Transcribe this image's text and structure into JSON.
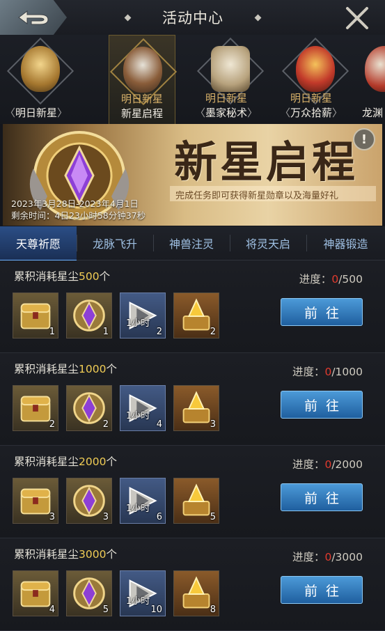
{
  "header": {
    "title": "活动中心"
  },
  "activities": [
    {
      "line1": "",
      "line2": "明日新星",
      "active": false
    },
    {
      "line1": "明日新星",
      "line2": "新星启程",
      "active": true
    },
    {
      "line1": "明日新星",
      "line2": "墨家秘术",
      "active": false
    },
    {
      "line1": "明日新星",
      "line2": "万众拾薪",
      "active": false
    },
    {
      "line1": "",
      "line2": "龙渊",
      "active": false
    }
  ],
  "banner": {
    "headline": "新星启程",
    "subtitle": "完成任务即可获得新星勋章以及海量好礼",
    "dates": "2023年3月28日-2023年4月1日",
    "remaining": "剩余时间：4日23小时58分钟37秒"
  },
  "tabs": [
    "天尊祈愿",
    "龙脉飞升",
    "神兽注灵",
    "将灵天启",
    "神器锻造"
  ],
  "task_prefix": "累积消耗星尘",
  "task_suffix": "个",
  "progress_label": "进度：",
  "go_label": "前往",
  "reward_tag": "1小时",
  "tasks": [
    {
      "target": "500",
      "current": "0",
      "total": "/500",
      "qty": [
        "1",
        "1",
        "2",
        "2"
      ]
    },
    {
      "target": "1000",
      "current": "0",
      "total": "/1000",
      "qty": [
        "2",
        "2",
        "4",
        "3"
      ]
    },
    {
      "target": "2000",
      "current": "0",
      "total": "/2000",
      "qty": [
        "3",
        "3",
        "6",
        "5"
      ]
    },
    {
      "target": "3000",
      "current": "0",
      "total": "/3000",
      "qty": [
        "4",
        "5",
        "10",
        "8"
      ]
    }
  ]
}
